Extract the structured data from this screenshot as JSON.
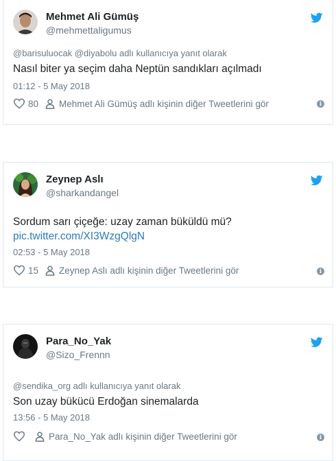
{
  "tweets": [
    {
      "name": "Mehmet Ali Gümüş",
      "handle": "@mehmettaligumus",
      "reply_to": "@barisuluocak @diyabolu adlı kullanıcıya yanıt olarak",
      "text": "Nasıl biter ya seçim daha Neptün sandıkları açılmadı",
      "time": "01:12 - 5 May 2018",
      "likes": "80",
      "more_tweets": "Mehmet Ali Gümüş adlı kişinin diğer Tweetlerini gör"
    },
    {
      "name": "Zeynep Aslı",
      "handle": "@sharkandangel",
      "text": "Sordum sarı çiçeğe: uzay zaman büküldü mü?",
      "link": "pic.twitter.com/XI3WzgQlgN",
      "time": "02:53 - 5 May 2018",
      "likes": "15",
      "more_tweets": "Zeynep Aslı adlı kişinin diğer Tweetlerini gör"
    },
    {
      "name": "Para_No_Yak",
      "handle": "@Sizo_Frennn",
      "reply_to": "@sendika_org adlı kullanıcıya yanıt olarak",
      "text": "Son uzay bükücü Erdoğan sinemalarda",
      "time": "13:56 - 5 May 2018",
      "likes": "",
      "more_tweets": "Para_No_Yak adlı kişinin diğer Tweetlerini gör"
    }
  ],
  "icons": {
    "brand": "twitter-bird-icon",
    "like": "heart-icon",
    "profile": "person-icon",
    "info": "info-icon"
  },
  "colors": {
    "twitter_blue": "#1da1f2",
    "link": "#2b7bb9",
    "muted": "#697882"
  }
}
